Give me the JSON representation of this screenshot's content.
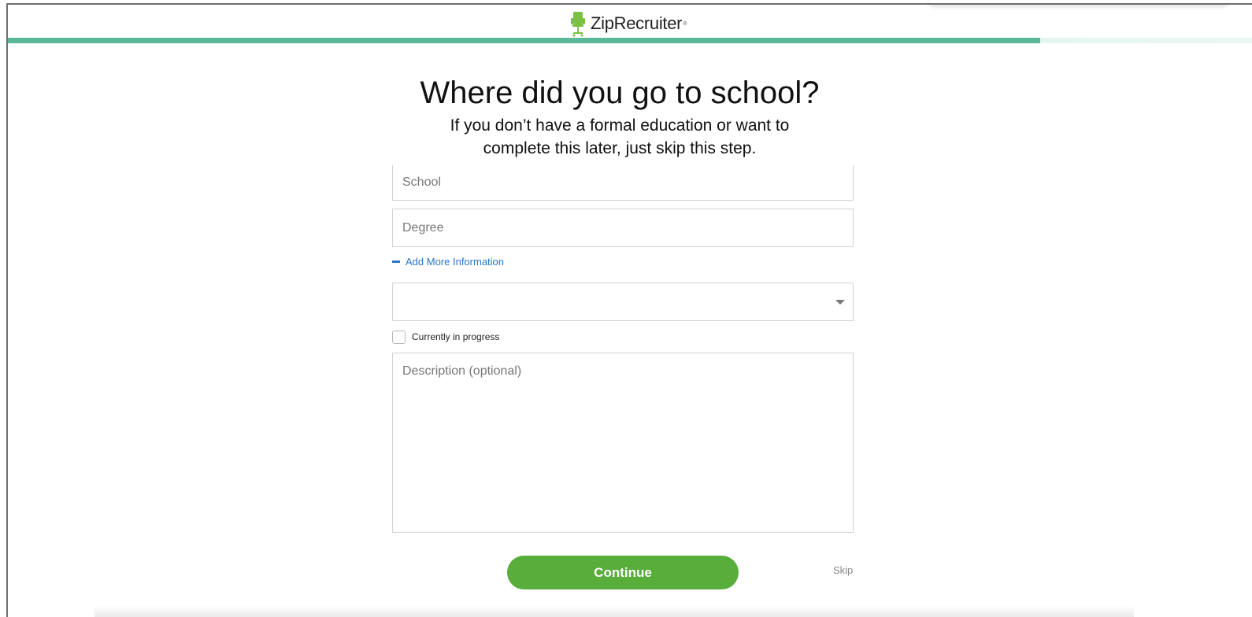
{
  "brand": {
    "name": "ZipRecruiter",
    "registered_mark": "®",
    "logo_icon": "chair-icon",
    "logo_color": "#7ac143"
  },
  "progress": {
    "fraction": 0.83,
    "fill_color": "#5bb99a",
    "track_color": "#d6f0e7"
  },
  "main": {
    "title": "Where did you go to school?",
    "subtitle": "If you don’t have a formal education or want to complete this later, just skip this step."
  },
  "form": {
    "school_placeholder": "School",
    "degree_placeholder": "Degree",
    "add_more_label": "Add More Information",
    "add_more_icon": "minus-icon",
    "select_icon": "caret-down-icon",
    "select_value": "",
    "in_progress_label": "Currently in progress",
    "description_placeholder": "Description (optional)"
  },
  "actions": {
    "continue_label": "Continue",
    "skip_label": "Skip",
    "continue_color": "#58ad3b"
  }
}
